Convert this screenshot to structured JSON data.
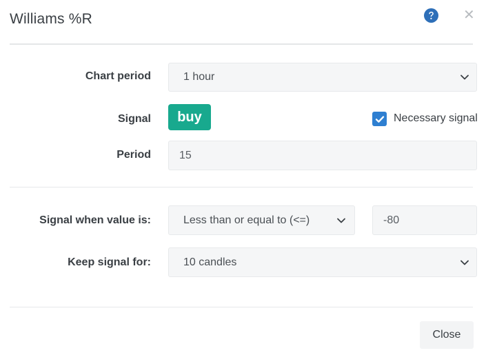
{
  "dialog": {
    "title": "Williams %R"
  },
  "form": {
    "chart_period": {
      "label": "Chart period",
      "value": "1 hour"
    },
    "signal": {
      "label": "Signal",
      "button_label": "buy",
      "necessary_label": "Necessary signal",
      "necessary_checked": true
    },
    "period": {
      "label": "Period",
      "value": "15"
    },
    "signal_when": {
      "label": "Signal when value is:",
      "condition": "Less than or equal to (<=)",
      "threshold": "-80"
    },
    "keep_signal": {
      "label": "Keep signal for:",
      "value": "10 candles"
    }
  },
  "footer": {
    "close_label": "Close"
  },
  "colors": {
    "buy_button": "#18a98e",
    "checkbox": "#2e7fd1",
    "help_icon": "#2e6fb8"
  },
  "icons": {
    "help": "question-circle-icon",
    "close": "close-icon",
    "dropdown": "chevron-down-icon",
    "check": "checkmark-icon"
  }
}
